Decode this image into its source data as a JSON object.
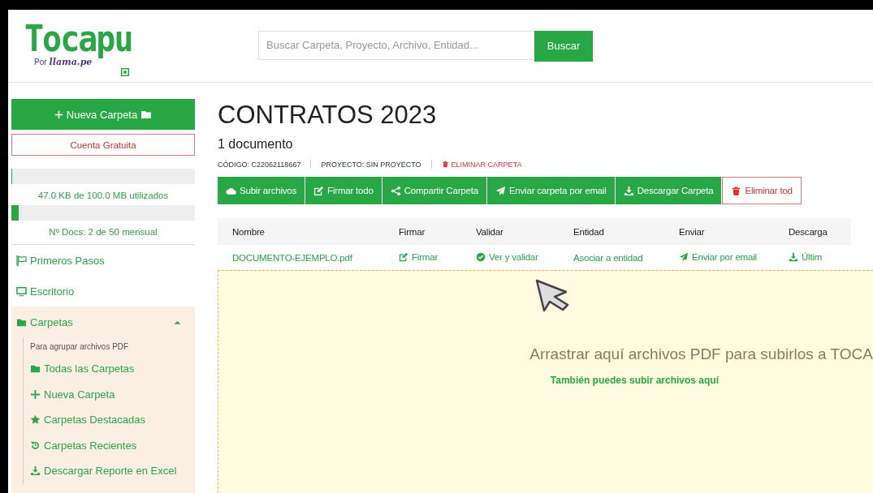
{
  "header": {
    "logo": {
      "name": "Tocapu",
      "by": "Por",
      "brand": "llama.pe"
    },
    "search": {
      "placeholder": "Buscar Carpeta, Proyecto, Archivo, Entidad...",
      "button": "Buscar"
    }
  },
  "sidebar": {
    "new_folder": "Nueva Carpeta",
    "account": "Cuenta Gratuita",
    "meters": [
      {
        "level": 0.005,
        "reading": "47.0 KB de 100.0 MB utilizados"
      },
      {
        "level": 0.04,
        "reading": "Nº Docs: 2 de 50 mensual"
      }
    ],
    "items": [
      {
        "label": "Primeros Pasos"
      },
      {
        "label": "Escritorio"
      }
    ],
    "section": {
      "label": "Carpetas",
      "expanded": true,
      "hint": "Para agrupar archivos PDF",
      "children": [
        {
          "label": "Todas las Carpetas"
        },
        {
          "label": "Nueva Carpeta"
        },
        {
          "label": "Carpetas Destacadas"
        },
        {
          "label": "Carpetas Recientes"
        },
        {
          "label": "Descargar Reporte en Excel"
        }
      ]
    }
  },
  "main": {
    "title": "CONTRATOS 2023",
    "count": "1 documento",
    "meta": [
      {
        "kind": "info",
        "text": "CÓDIGO: C22062118667"
      },
      {
        "kind": "info",
        "text": "PROYECTO: SIN PROYECTO"
      },
      {
        "kind": "danger",
        "text": "ELIMINAR CARPETA"
      }
    ],
    "actions": [
      {
        "kind": "primary",
        "label": "Subir archivos"
      },
      {
        "kind": "primary",
        "label": "Firmar todo"
      },
      {
        "kind": "primary",
        "label": "Compartir Carpeta"
      },
      {
        "kind": "primary",
        "label": "Enviar carpeta por email"
      },
      {
        "kind": "primary",
        "label": "Descargar Carpeta"
      },
      {
        "kind": "danger",
        "label": "Eliminar tod"
      }
    ],
    "table": {
      "columns": [
        "Nombre",
        "Firmar",
        "Validar",
        "Entidad",
        "Enviar",
        "Descarga"
      ],
      "rows": [
        {
          "cells": [
            "DOCUMENTO-EJEMPLO.pdf",
            "Firmar",
            "Ver y validar",
            "Asociar a entidad",
            "Enviar por email",
            "Últim"
          ]
        }
      ]
    },
    "dropzone": {
      "text": "Arrastrar aquí archivos PDF para subirlos a TOCA",
      "link": "También puedes subir archivos aquí"
    }
  }
}
